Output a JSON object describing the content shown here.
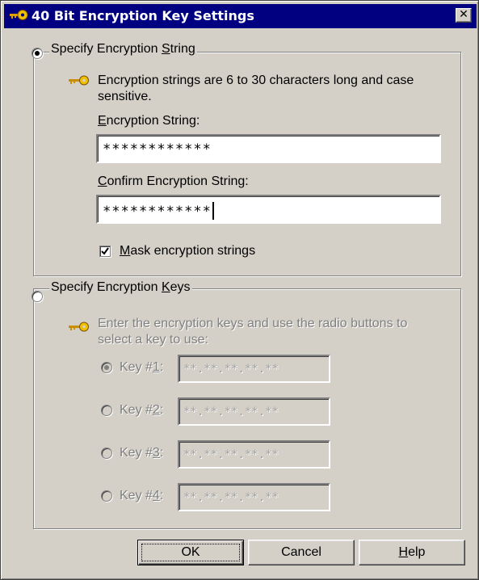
{
  "window": {
    "title": "40 Bit Encryption Key Settings",
    "close_glyph": "✕"
  },
  "string_group": {
    "legend_pre": "Specify Encryption ",
    "legend_acc": "S",
    "legend_post": "tring",
    "selected": true,
    "info_line1": "Encryption strings are 6 to 30 characters long and case",
    "info_line2": "sensitive.",
    "string_label_acc": "E",
    "string_label_rest": "ncryption String:",
    "string_value": "************",
    "confirm_label_acc": "C",
    "confirm_label_rest": "onfirm Encryption String:",
    "confirm_value": "************",
    "mask_checked": true,
    "mask_label_acc": "M",
    "mask_label_rest": "ask encryption strings"
  },
  "keys_group": {
    "legend_pre": "Specify Encryption ",
    "legend_acc": "K",
    "legend_post": "eys",
    "selected": false,
    "info_line1": "Enter the encryption keys and use the radio buttons to",
    "info_line2": "select a key to use:",
    "keys": [
      {
        "pre": "Key #",
        "acc": "1",
        "post": ":",
        "value": "**.**.**.**.**",
        "selected": true
      },
      {
        "pre": "Key #",
        "acc": "2",
        "post": ":",
        "value": "**.**.**.**.**",
        "selected": false
      },
      {
        "pre": "Key #",
        "acc": "3",
        "post": ":",
        "value": "**.**.**.**.**",
        "selected": false
      },
      {
        "pre": "Key #",
        "acc": "4",
        "post": ":",
        "value": "**.**.**.**.**",
        "selected": false
      }
    ]
  },
  "buttons": {
    "ok": "OK",
    "cancel": "Cancel",
    "help_acc": "H",
    "help_rest": "elp"
  },
  "icons": {
    "key_icon": "key-icon",
    "accent": "#000080"
  }
}
